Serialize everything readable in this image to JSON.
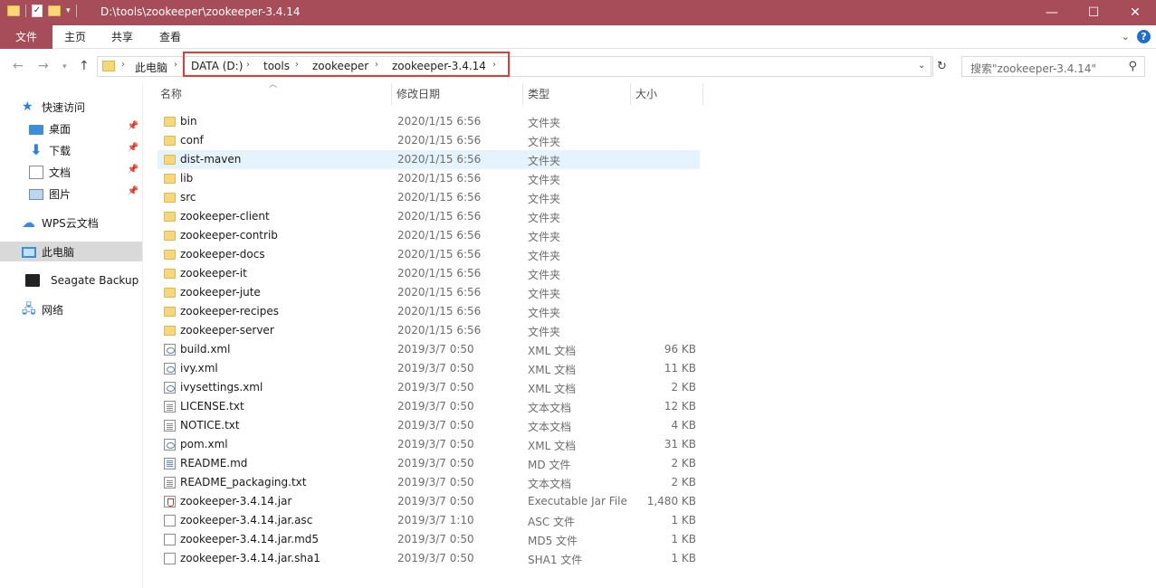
{
  "window": {
    "title": "D:\\tools\\zookeeper\\zookeeper-3.4.14",
    "minimize": "—",
    "maximize": "☐",
    "close": "✕"
  },
  "ribbon": {
    "tabs": [
      "文件",
      "主页",
      "共享",
      "查看"
    ],
    "help": "?"
  },
  "address": {
    "crumbs": [
      "此电脑",
      "DATA (D:)",
      "tools",
      "zookeeper",
      "zookeeper-3.4.14"
    ],
    "search_placeholder": "搜索\"zookeeper-3.4.14\""
  },
  "nav": {
    "items": [
      {
        "label": "快速访问",
        "icon": "star-icon",
        "pinned": false
      },
      {
        "label": "桌面",
        "icon": "desktop-icon",
        "pinned": true
      },
      {
        "label": "下载",
        "icon": "download-icon",
        "pinned": true
      },
      {
        "label": "文档",
        "icon": "document-icon",
        "pinned": true
      },
      {
        "label": "图片",
        "icon": "pictures-icon",
        "pinned": true
      },
      {
        "label": "WPS云文档",
        "icon": "cloud-icon",
        "pinned": false
      },
      {
        "label": "此电脑",
        "icon": "computer-icon",
        "pinned": false
      },
      {
        "label": "Seagate Backup Plu",
        "icon": "drive-icon",
        "pinned": false
      },
      {
        "label": "网络",
        "icon": "network-icon",
        "pinned": false
      }
    ]
  },
  "columns": {
    "name": "名称",
    "date": "修改日期",
    "type": "类型",
    "size": "大小"
  },
  "files": [
    {
      "name": "bin",
      "date": "2020/1/15 6:56",
      "type": "文件夹",
      "size": "",
      "icon": "folder"
    },
    {
      "name": "conf",
      "date": "2020/1/15 6:56",
      "type": "文件夹",
      "size": "",
      "icon": "folder"
    },
    {
      "name": "dist-maven",
      "date": "2020/1/15 6:56",
      "type": "文件夹",
      "size": "",
      "icon": "folder",
      "hover": true
    },
    {
      "name": "lib",
      "date": "2020/1/15 6:56",
      "type": "文件夹",
      "size": "",
      "icon": "folder"
    },
    {
      "name": "src",
      "date": "2020/1/15 6:56",
      "type": "文件夹",
      "size": "",
      "icon": "folder"
    },
    {
      "name": "zookeeper-client",
      "date": "2020/1/15 6:56",
      "type": "文件夹",
      "size": "",
      "icon": "folder"
    },
    {
      "name": "zookeeper-contrib",
      "date": "2020/1/15 6:56",
      "type": "文件夹",
      "size": "",
      "icon": "folder"
    },
    {
      "name": "zookeeper-docs",
      "date": "2020/1/15 6:56",
      "type": "文件夹",
      "size": "",
      "icon": "folder"
    },
    {
      "name": "zookeeper-it",
      "date": "2020/1/15 6:56",
      "type": "文件夹",
      "size": "",
      "icon": "folder"
    },
    {
      "name": "zookeeper-jute",
      "date": "2020/1/15 6:56",
      "type": "文件夹",
      "size": "",
      "icon": "folder"
    },
    {
      "name": "zookeeper-recipes",
      "date": "2020/1/15 6:56",
      "type": "文件夹",
      "size": "",
      "icon": "folder"
    },
    {
      "name": "zookeeper-server",
      "date": "2020/1/15 6:56",
      "type": "文件夹",
      "size": "",
      "icon": "folder"
    },
    {
      "name": "build.xml",
      "date": "2019/3/7 0:50",
      "type": "XML 文档",
      "size": "96 KB",
      "icon": "xml"
    },
    {
      "name": "ivy.xml",
      "date": "2019/3/7 0:50",
      "type": "XML 文档",
      "size": "11 KB",
      "icon": "xml"
    },
    {
      "name": "ivysettings.xml",
      "date": "2019/3/7 0:50",
      "type": "XML 文档",
      "size": "2 KB",
      "icon": "xml"
    },
    {
      "name": "LICENSE.txt",
      "date": "2019/3/7 0:50",
      "type": "文本文档",
      "size": "12 KB",
      "icon": "text"
    },
    {
      "name": "NOTICE.txt",
      "date": "2019/3/7 0:50",
      "type": "文本文档",
      "size": "4 KB",
      "icon": "text"
    },
    {
      "name": "pom.xml",
      "date": "2019/3/7 0:50",
      "type": "XML 文档",
      "size": "31 KB",
      "icon": "xml"
    },
    {
      "name": "README.md",
      "date": "2019/3/7 0:50",
      "type": "MD 文件",
      "size": "2 KB",
      "icon": "md"
    },
    {
      "name": "README_packaging.txt",
      "date": "2019/3/7 0:50",
      "type": "文本文档",
      "size": "2 KB",
      "icon": "text"
    },
    {
      "name": "zookeeper-3.4.14.jar",
      "date": "2019/3/7 0:50",
      "type": "Executable Jar File",
      "size": "1,480 KB",
      "icon": "jar"
    },
    {
      "name": "zookeeper-3.4.14.jar.asc",
      "date": "2019/3/7 1:10",
      "type": "ASC 文件",
      "size": "1 KB",
      "icon": "blank"
    },
    {
      "name": "zookeeper-3.4.14.jar.md5",
      "date": "2019/3/7 0:50",
      "type": "MD5 文件",
      "size": "1 KB",
      "icon": "blank"
    },
    {
      "name": "zookeeper-3.4.14.jar.sha1",
      "date": "2019/3/7 0:50",
      "type": "SHA1 文件",
      "size": "1 KB",
      "icon": "blank"
    }
  ],
  "colors": {
    "titlebar": "#a64d59",
    "highlight_box": "#e53935",
    "hover_row": "#e5f3ff",
    "nav_selected": "#d9d9d9"
  }
}
